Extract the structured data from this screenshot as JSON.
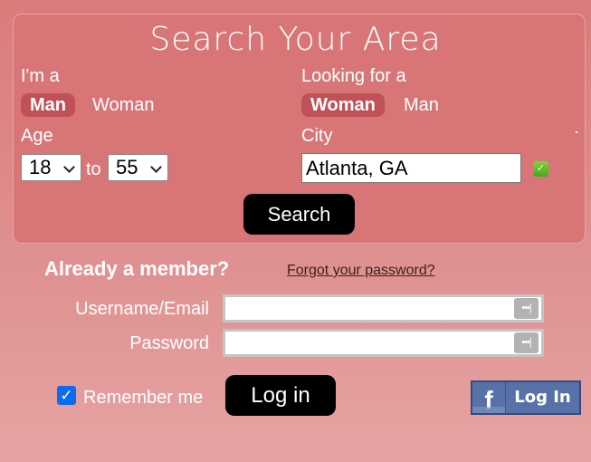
{
  "search": {
    "title": "Search Your Area",
    "im_a": {
      "label": "I'm a",
      "options": [
        {
          "label": "Man",
          "selected": true
        },
        {
          "label": "Woman",
          "selected": false
        }
      ]
    },
    "looking_for": {
      "label": "Looking for a",
      "options": [
        {
          "label": "Woman",
          "selected": true
        },
        {
          "label": "Man",
          "selected": false
        }
      ]
    },
    "age": {
      "label": "Age",
      "from": "18",
      "to_label": "to",
      "to": "55"
    },
    "city": {
      "label": "City",
      "value": "Atlanta, GA",
      "valid_icon": "checkmark-icon"
    },
    "search_button": "Search"
  },
  "login": {
    "title": "Already a member?",
    "forgot_link": "Forgot your password?",
    "username_label": "Username/Email",
    "username_value": "",
    "password_label": "Password",
    "password_value": "",
    "password_manager_icon": "•••|",
    "remember_label": "Remember me",
    "remember_checked": true,
    "login_button": "Log in",
    "facebook": {
      "icon": "f",
      "label": "Log In"
    }
  },
  "colors": {
    "panel": "#d87677",
    "active_segment": "#c05257",
    "button": "#000000",
    "facebook": "#5872a9",
    "checkbox": "#0b6cf0"
  }
}
